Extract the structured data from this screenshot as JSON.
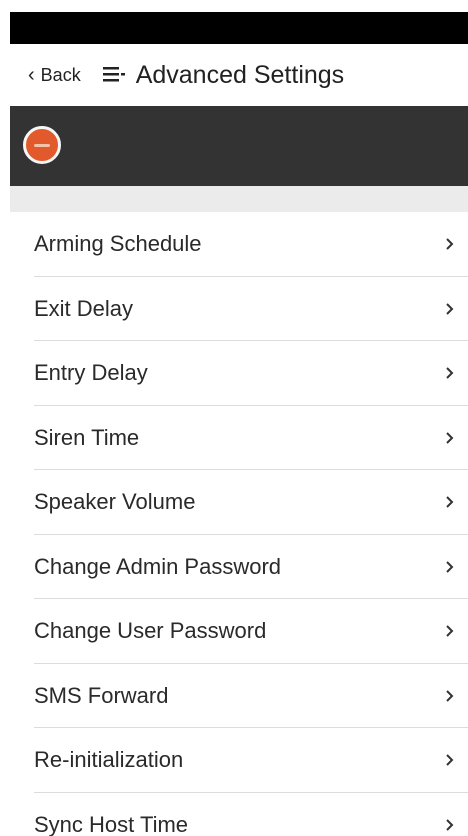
{
  "header": {
    "back_label": "Back",
    "title": "Advanced Settings"
  },
  "icons": {
    "back": "chevron-left-icon",
    "menu": "menu-icon",
    "item_arrow": "chevron-right-icon",
    "logo": "brand-logo"
  },
  "colors": {
    "status_bar": "#000000",
    "brand_bar": "#333333",
    "logo": "#e25a2b",
    "divider": "#dcdcdc"
  },
  "settings": {
    "items": [
      {
        "label": "Arming Schedule"
      },
      {
        "label": "Exit Delay"
      },
      {
        "label": "Entry Delay"
      },
      {
        "label": "Siren Time"
      },
      {
        "label": "Speaker Volume"
      },
      {
        "label": "Change Admin Password"
      },
      {
        "label": "Change User Password"
      },
      {
        "label": "SMS Forward"
      },
      {
        "label": "Re-initialization"
      },
      {
        "label": "Sync Host Time"
      }
    ]
  }
}
